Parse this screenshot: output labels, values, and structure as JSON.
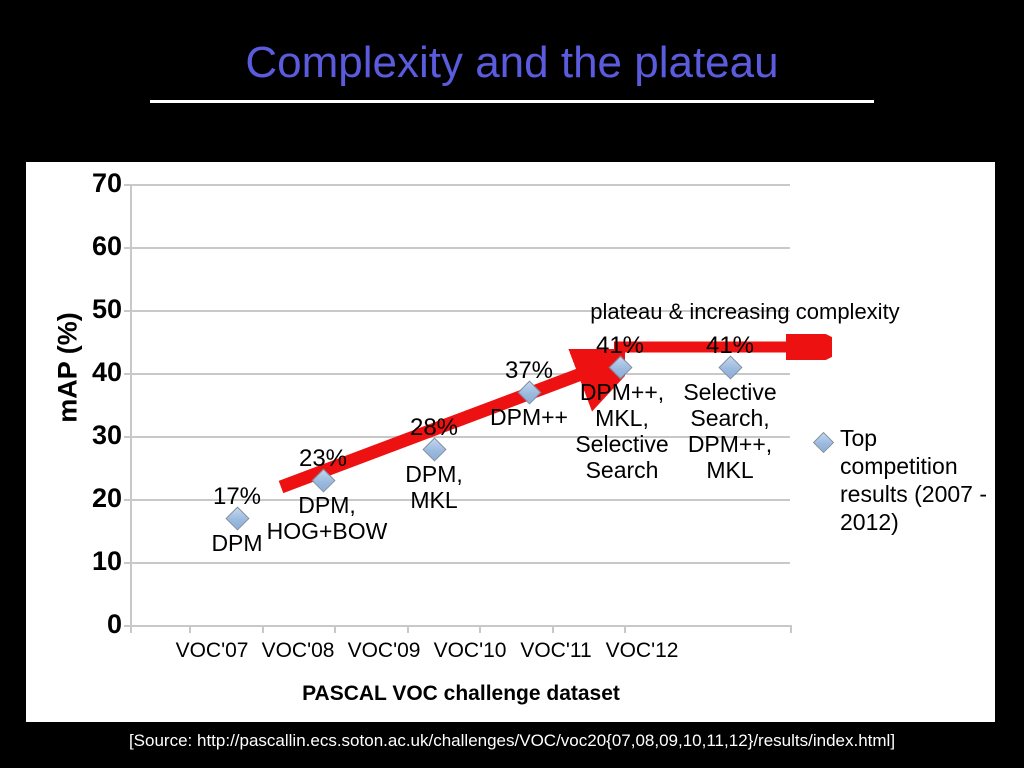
{
  "slide": {
    "title": "Complexity and the plateau",
    "title_color": "#5b5bdd",
    "background_color": "#000000",
    "source": "[Source: http://pascallin.ecs.soton.ac.uk/challenges/VOC/voc20{07,08,09,10,11,12}/results/index.html]"
  },
  "chart_data": {
    "type": "scatter",
    "title": "",
    "xlabel": "PASCAL VOC challenge dataset",
    "ylabel": "mAP (%)",
    "ylim": [
      0,
      70
    ],
    "yticks": [
      0,
      10,
      20,
      30,
      40,
      50,
      60,
      70
    ],
    "ytick_labels": [
      "0",
      "10",
      "20",
      "30",
      "40",
      "50",
      "60",
      "70"
    ],
    "grid": true,
    "legend_position": "right",
    "categories": [
      "VOC'07",
      "VOC'08",
      "VOC'09",
      "VOC'10",
      "VOC'11",
      "VOC'12"
    ],
    "series": [
      {
        "name": "Top competition results (2007 - 2012)",
        "marker": "diamond",
        "marker_color": "#9cbadf",
        "marker_edge_color": "#7a8ba0",
        "values": [
          17,
          23,
          28,
          37,
          41,
          41
        ],
        "point_value_labels": [
          "17%",
          "23%",
          "28%",
          "37%",
          "41%",
          "41%"
        ],
        "point_method_labels": [
          "DPM",
          "DPM,\nHOG+BOW",
          "DPM,\nMKL",
          "DPM++",
          "DPM++,\nMKL,\nSelective\nSearch",
          "Selective\nSearch,\nDPM++,\nMKL"
        ]
      }
    ],
    "annotations": [
      {
        "text": "plateau & increasing complexity",
        "kind": "text"
      },
      {
        "text": "",
        "kind": "arrow-diagonal",
        "color": "#ee1111"
      },
      {
        "text": "",
        "kind": "arrow-horizontal",
        "color": "#ee1111"
      }
    ],
    "legend": {
      "entries": [
        {
          "label": "Top competition results (2007 - 2012)",
          "marker": "diamond"
        }
      ]
    }
  }
}
